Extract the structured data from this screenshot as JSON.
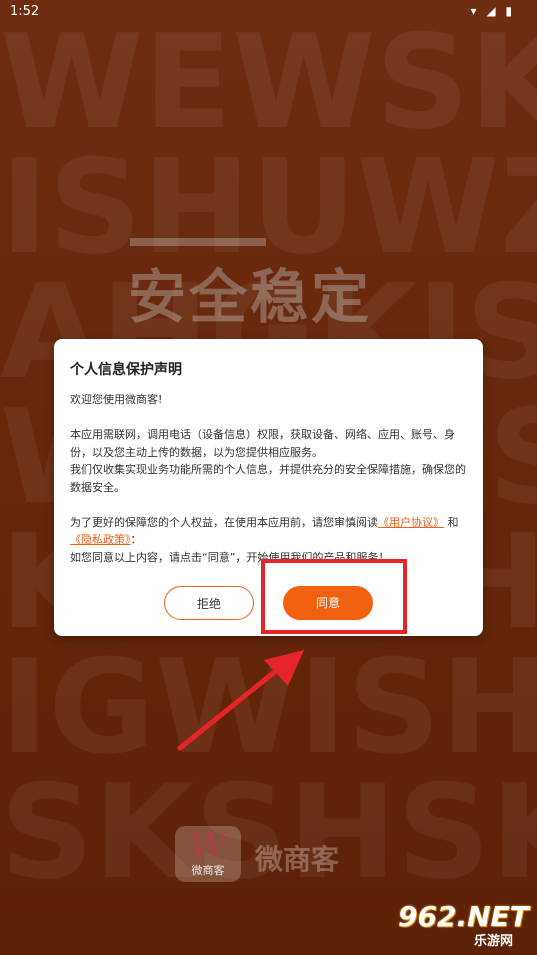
{
  "status_bar": {
    "time": "1:52",
    "icons": "▾ ◢ ▮"
  },
  "background": {
    "slogan_line1": "安全稳定",
    "slogan_line2": "安全稳定",
    "brand_logo_text": "微商客",
    "brand_logo_letter": "W",
    "brand_name": "微商客"
  },
  "dialog": {
    "title": "个人信息保护声明",
    "welcome": "欢迎您使用微商客!",
    "para1": "本应用需联网，调用电话（设备信息）权限，获取设备、网络、应用、账号、身份，以及您主动上传的数据，以为您提供相应服务。",
    "para2": "我们仅收集实现业务功能所需的个人信息，并提供充分的安全保障措施，确保您的数据安全。",
    "para3_prefix": "为了更好的保障您的个人权益，在使用本应用前，请您审慎阅读",
    "user_agreement_link": "《用户协议》",
    "and_text": "和",
    "privacy_policy_link": "《隐私政策》",
    "colon": "：",
    "para4": "如您同意以上内容，请点击“同意”，开始使用我们的产品和服务！",
    "reject_label": "拒绝",
    "agree_label": "同意"
  },
  "watermark": {
    "number": "962.NET",
    "site": "乐游网"
  },
  "colors": {
    "accent": "#f06018",
    "background": "#6a2a0e",
    "highlight": "#e52528"
  }
}
